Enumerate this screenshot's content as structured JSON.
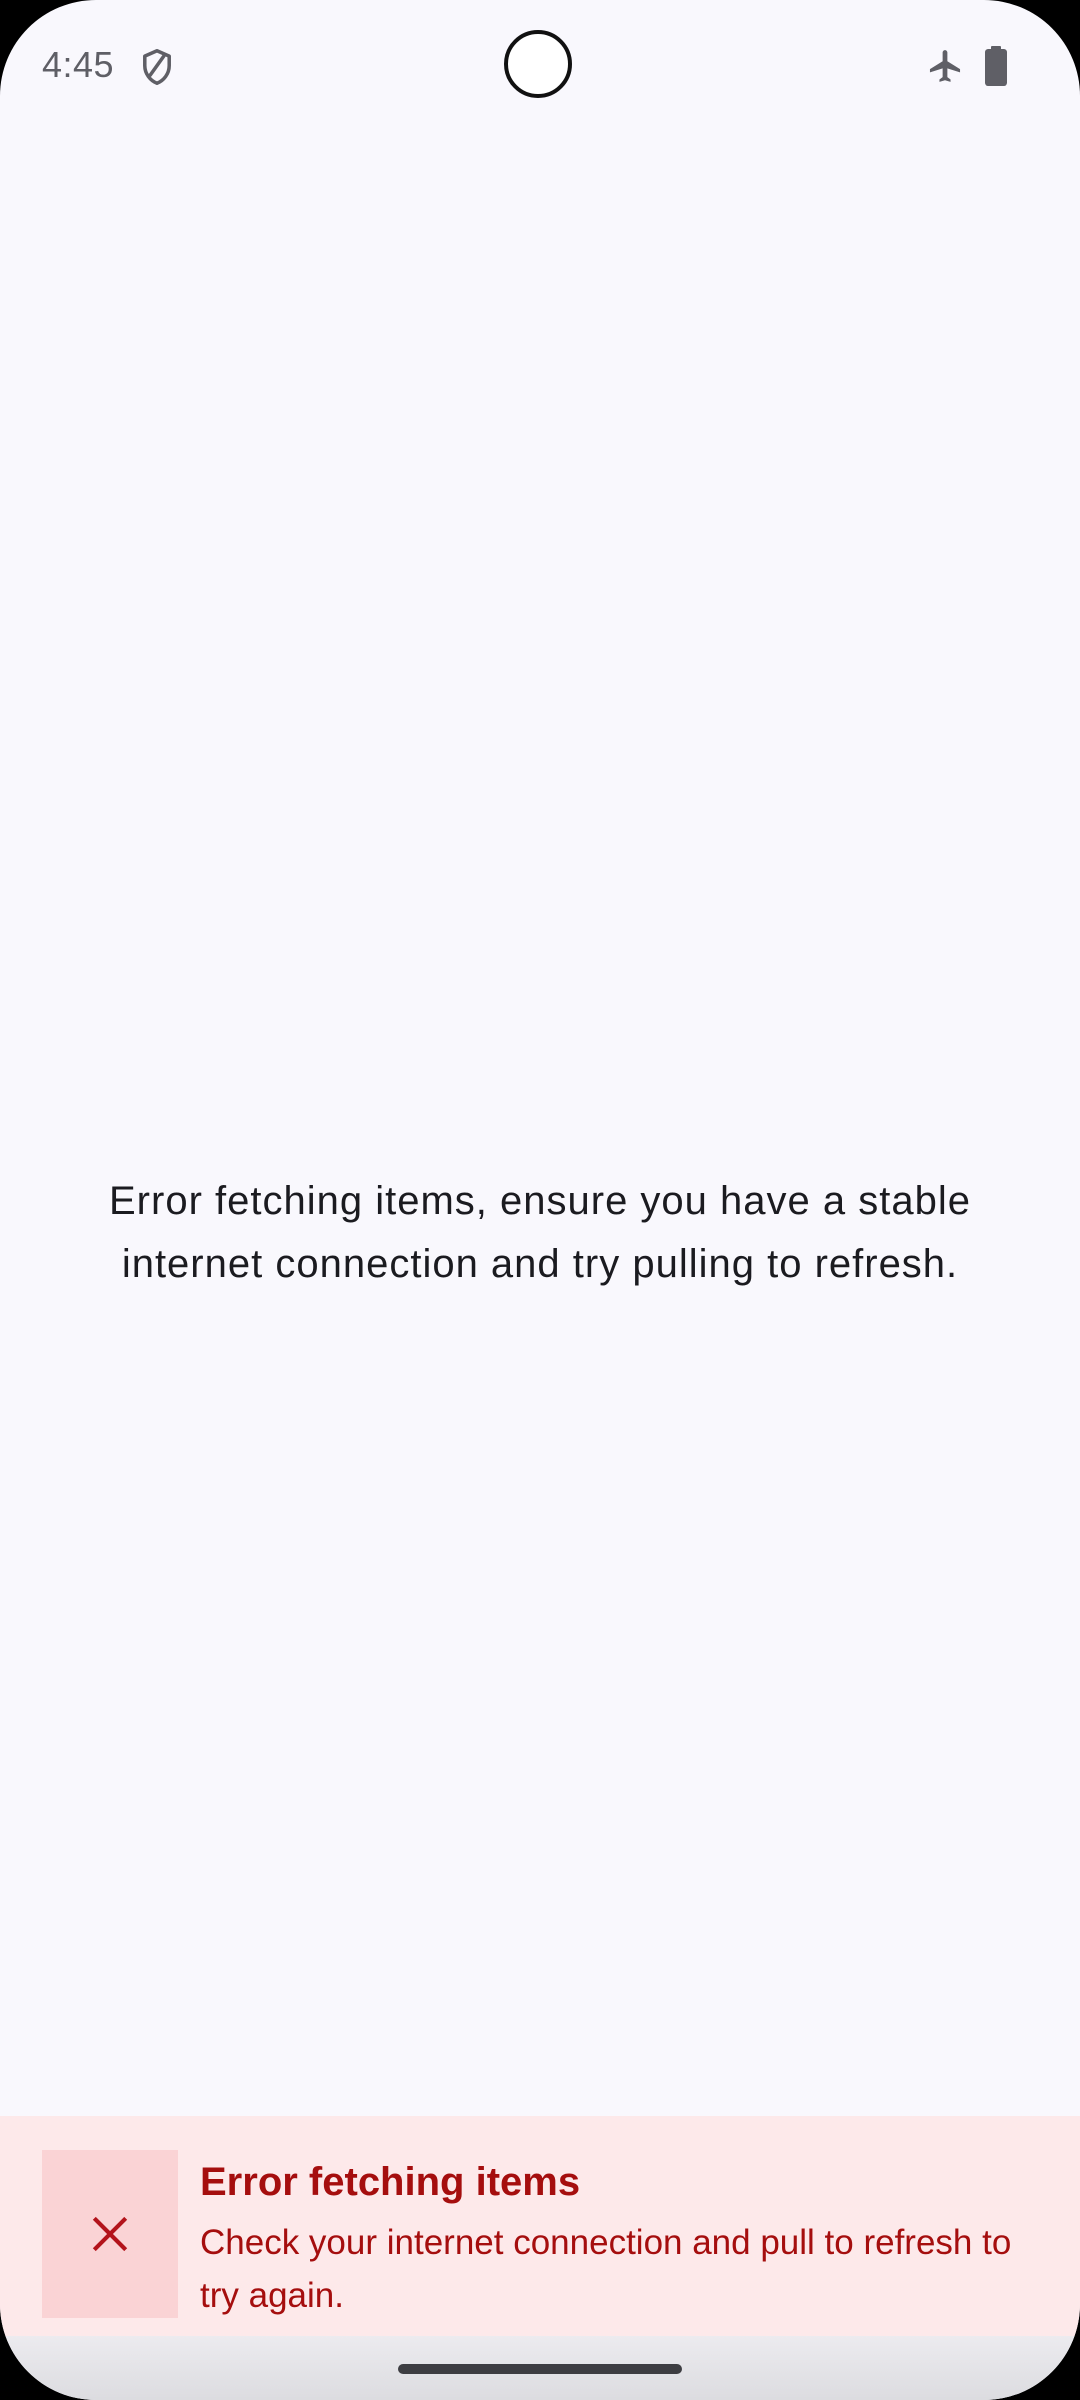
{
  "status_bar": {
    "time": "4:45",
    "icons": [
      "shield-icon",
      "airplane-icon",
      "battery-icon"
    ]
  },
  "main": {
    "message_line_1": "Error fetching items, ensure you have a stable",
    "message_line_2": "internet connection and try pulling to refresh."
  },
  "toast": {
    "title": "Error fetching items",
    "body": "Check your internet connection and pull to refresh to try again.",
    "close_icon": "close-icon"
  },
  "colors": {
    "background": "#f9f8fd",
    "toast_background": "#fde9ea",
    "toast_icon_background": "#fad3d5",
    "error_text": "#a50e0e",
    "body_text": "#1b1b20"
  }
}
